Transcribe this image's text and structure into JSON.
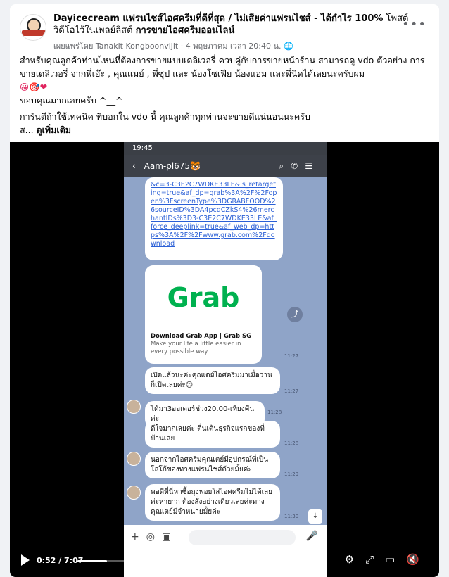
{
  "post": {
    "page_name": "Dayicecream แฟรนไชส์ไอศครีมที่ดีที่สุด / ไม่เสียค่าแฟรนไชส์ - ได้กำไร 100%",
    "posted_video_prefix": "โพสต์วิดีโอไว้ในเพลย์ลิสต์",
    "playlist_name": "การขายไอศครีมออนไลน์",
    "meta_published_by": "เผยแพร่โดย Tanakit Kongboonvijit",
    "meta_date": "4 พฤษภาคม เวลา 20:40 น.",
    "line1": "สำหรับคุณลูกค้าท่านไหนที่ต้องการขายแบบเดลิเวอรี่ ควบคู่กับการขายหน้าร้าน สามารถดู vdo ตัวอย่าง การขายเดลิเวอรี่ จากพี่เอ๊ะ , คุณแมย์ , พี่ซุป และ น้องโซเฟีย น้องแอม และพี่นิดได้เลยนะครับผม",
    "emoji_line": "😀🎯❤",
    "thanks": "ขอบคุณมากเลยครับ ^__^",
    "line2": "การันตีถ้าใช้เทคนิค ที่บอกใน vdo นี้ คุณลูกค้าทุกท่านจะขายดีแน่นอนนะครับ",
    "see_more_prefix": "ส...",
    "see_more_label": "ดูเพิ่มเติม",
    "more_icon": "more-dots-icon"
  },
  "phone": {
    "status_time": "19:45",
    "chat_name": "Aam-pl675🐯",
    "link_text": "&c=3-C3E2C7WDKE33LE&is_retargeting=true&af_dp=grab%3A%2F%2Fopen%3FscreenType%3DGRABFOOD%26sourceID%3DA4pcqCZkS4%26merchantIDs%3D3-C3E2C7WDKE33LE&af_force_deeplink=true&af_web_dp=https%3A%2F%2Fwww.grab.com%2Fdownload",
    "grab_logo": "Grab",
    "grab_title": "Download Grab App | Grab SG",
    "grab_desc": "Make your life a little easier in every possible way.",
    "time_1": "11:27",
    "time_2": "11:27",
    "msg_sent_1": "เปิดแล้วนะค่ะคุณเตย์ไอศครีมมาเมื่อวานก็เปิดเลยค่ะ😊",
    "msg_recv_1": "ได้มา3ออเดอร์ช่วง20.00-เที่ยงคืนค่ะ",
    "time_3": "11:28",
    "msg_sent_2": "ดีใจมากเลยค่ะ ตื่นเต้นธุรกิจแรกของที่บ้านเลย",
    "time_4": "11:28",
    "msg_recv_2": "นอกจากไอศครีมคุณเตย์มีอุปกรณ์ที่เป็นโลโก้ของทางแฟรนไชส์ด้วยมั้ยค่ะ",
    "time_5": "11:29",
    "msg_recv_3": "พอดีที่นี่หาซื้อถุงฟอยใส่ไอศครีมไม่ได้เลยค่ะหายาก ต้องสั่งอย่างเดียวเลยค่ะทางคุณเตย์มีจำหน่ายมั้ยค่ะ",
    "time_6": "11:30"
  },
  "video": {
    "time_display": "0:52 / 7:07",
    "progress": 0.122
  }
}
